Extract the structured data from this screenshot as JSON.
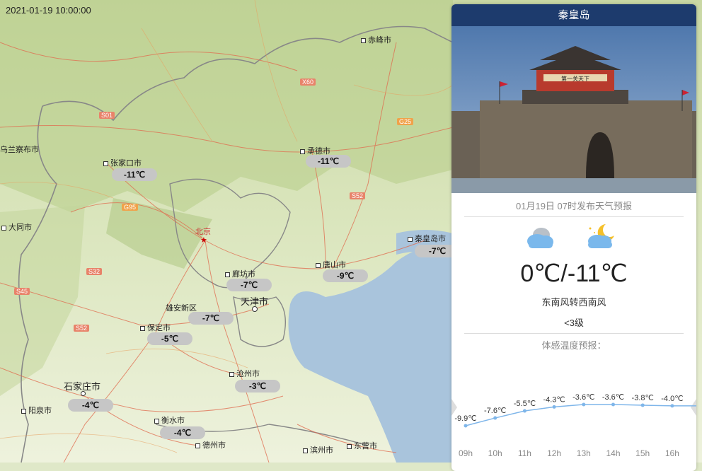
{
  "timestamp": "2021-01-19 10:00:00",
  "map": {
    "capital_label": "北京",
    "cities": [
      {
        "name": "赤峰市"
      },
      {
        "name": "乌兰察布市"
      },
      {
        "name": "张家口市"
      },
      {
        "name": "承德市"
      },
      {
        "name": "大同市"
      },
      {
        "name": "秦皇岛市"
      },
      {
        "name": "廊坊市"
      },
      {
        "name": "唐山市"
      },
      {
        "name": "天津市"
      },
      {
        "name": "雄安新区"
      },
      {
        "name": "保定市"
      },
      {
        "name": "沧州市"
      },
      {
        "name": "石家庄市"
      },
      {
        "name": "阳泉市"
      },
      {
        "name": "衡水市"
      },
      {
        "name": "德州市"
      },
      {
        "name": "滨州市"
      },
      {
        "name": "东营市"
      }
    ],
    "temps": {
      "zhangjiakou": "-11℃",
      "chengde": "-11℃",
      "qinhuangdao": "-7℃",
      "langfang": "-7℃",
      "tangshan": "-9℃",
      "xiongan": "-7℃",
      "baoding": "-5℃",
      "cangzhou": "-3℃",
      "shijiazhuang": "-4℃",
      "hengshui": "-4℃"
    },
    "road_shields": [
      "S01",
      "X60",
      "G25",
      "S52",
      "G95",
      "S32",
      "S45",
      "S52"
    ]
  },
  "panel": {
    "title": "秦皇岛",
    "photo_sign": "第一关天下",
    "forecast_meta": "01月19日 07时发布天气预报",
    "day_icon": "cloudy-icon",
    "night_icon": "partly-cloudy-night-icon",
    "temp_range": "0℃/-11℃",
    "wind": "东南风转西南风",
    "wind_level": "<3级",
    "feels_like_title": "体感温度预报："
  },
  "chart_data": {
    "type": "line",
    "categories": [
      "09h",
      "10h",
      "11h",
      "12h",
      "13h",
      "14h",
      "15h",
      "16h"
    ],
    "series": [
      {
        "values": [
          -9.9,
          -7.6,
          -5.5,
          -4.3,
          -3.6,
          -3.6,
          -3.8,
          -4.0
        ]
      }
    ],
    "labels": [
      "-9.9℃",
      "-7.6℃",
      "-5.5℃",
      "-4.3℃",
      "-3.6℃",
      "-3.6℃",
      "-3.8℃",
      "-4.0℃"
    ],
    "line_color": "#7fb6ea"
  }
}
